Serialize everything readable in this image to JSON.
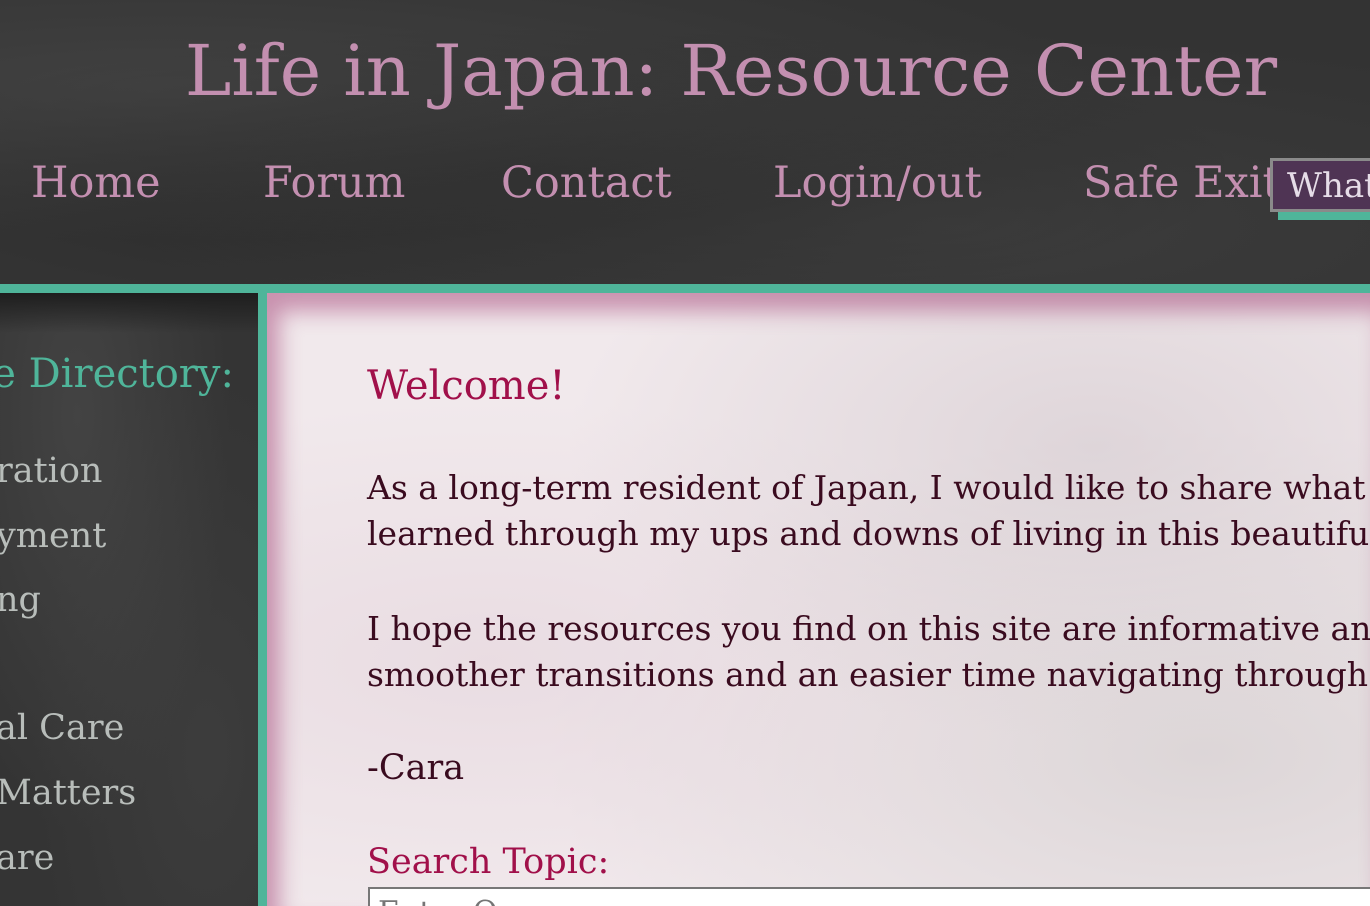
{
  "header": {
    "title": "Life in Japan: Resource Center",
    "nav": [
      "Home",
      "Forum",
      "Contact",
      "Login/out",
      "Safe Exit"
    ],
    "quick_box_text": "What"
  },
  "sidebar": {
    "title": "ce Directory:",
    "items": [
      "ration",
      "yment",
      "ng",
      "al Care",
      "Matters",
      "are"
    ]
  },
  "main": {
    "welcome": "Welcome!",
    "paragraph1": [
      "As a long-term resident of Japan, I would like to share what I",
      "learned through my ups and downs of living in this beautiful"
    ],
    "paragraph2": [
      "I hope the resources you find on this site are informative and",
      "smoother transitions and an easier time navigating through l"
    ],
    "signature": "-Cara",
    "search_label": "Search Topic:",
    "search_placeholder": "Enter Q..."
  },
  "colors": {
    "accent_pink": "#c38fb0",
    "teal": "#4fb59a",
    "crimson": "#a1104a",
    "dark_bg": "#333333"
  }
}
